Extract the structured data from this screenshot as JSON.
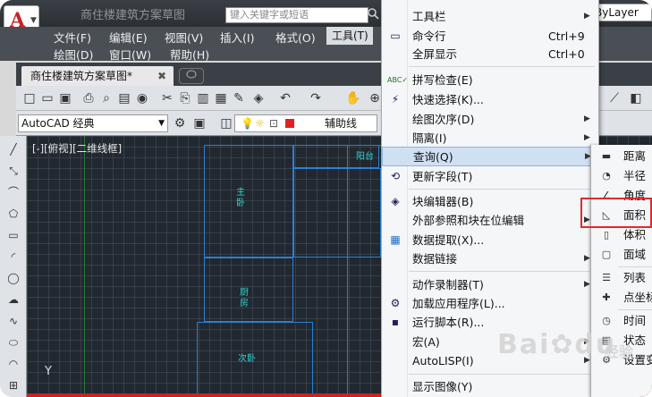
{
  "titlebar": {
    "app_letter": "A",
    "title": "商住楼建筑方案草图",
    "search_placeholder": "键入关键字或短语"
  },
  "menubar": {
    "items": [
      "文件(F)",
      "编辑(E)",
      "视图(V)",
      "插入(I)",
      "格式(O)",
      "工具(T)",
      "绘图(D)",
      "窗口(W)",
      "帮助(H)"
    ]
  },
  "doc_tab": {
    "label": "商住楼建筑方案草图*",
    "close": "✖"
  },
  "toolbar": {
    "workspace": "AutoCAD 经典",
    "layer": "辅助线",
    "linetype": "ByLayer"
  },
  "canvas": {
    "view_label": "[-][俯视][二维线框]",
    "rooms": [
      "主卧",
      "厨房",
      "次卧",
      "阳台"
    ],
    "ucs_y": "Y",
    "grid_color": "#212830",
    "wall_color": "#2d7fd0"
  },
  "tools_menu": {
    "items": [
      {
        "label": "工具栏",
        "shortcut": "",
        "submenu": true
      },
      {
        "label": "命令行",
        "shortcut": "Ctrl+9",
        "submenu": false
      },
      {
        "label": "全屏显示",
        "shortcut": "Ctrl+0",
        "submenu": false
      },
      {
        "label": "拼写检查(E)",
        "shortcut": "",
        "submenu": false
      },
      {
        "label": "快速选择(K)...",
        "shortcut": "",
        "submenu": false
      },
      {
        "label": "绘图次序(D)",
        "shortcut": "",
        "submenu": true
      },
      {
        "label": "隔离(I)",
        "shortcut": "",
        "submenu": true
      },
      {
        "label": "查询(Q)",
        "shortcut": "",
        "submenu": true
      },
      {
        "label": "更新字段(T)",
        "shortcut": "",
        "submenu": false
      },
      {
        "label": "块编辑器(B)",
        "shortcut": "",
        "submenu": false
      },
      {
        "label": "外部参照和块在位编辑",
        "shortcut": "",
        "submenu": true
      },
      {
        "label": "数据提取(X)...",
        "shortcut": "",
        "submenu": false
      },
      {
        "label": "数据链接",
        "shortcut": "",
        "submenu": true
      },
      {
        "label": "动作录制器(T)",
        "shortcut": "",
        "submenu": true
      },
      {
        "label": "加载应用程序(L)...",
        "shortcut": "",
        "submenu": false
      },
      {
        "label": "运行脚本(R)...",
        "shortcut": "",
        "submenu": false
      },
      {
        "label": "宏(A)",
        "shortcut": "",
        "submenu": true
      },
      {
        "label": "AutoLISP(I)",
        "shortcut": "",
        "submenu": true
      },
      {
        "label": "显示图像(Y)",
        "shortcut": "",
        "submenu": true
      }
    ],
    "highlighted": "查询(Q)"
  },
  "query_submenu": {
    "items": [
      "距离",
      "半径",
      "角度",
      "面积",
      "体积",
      "面域",
      "列表",
      "点坐标",
      "时间",
      "状态",
      "设置变量"
    ],
    "highlighted": "面积"
  },
  "watermark": {
    "brand": "Bai",
    "brand2": "du",
    "suffix": "经验"
  }
}
